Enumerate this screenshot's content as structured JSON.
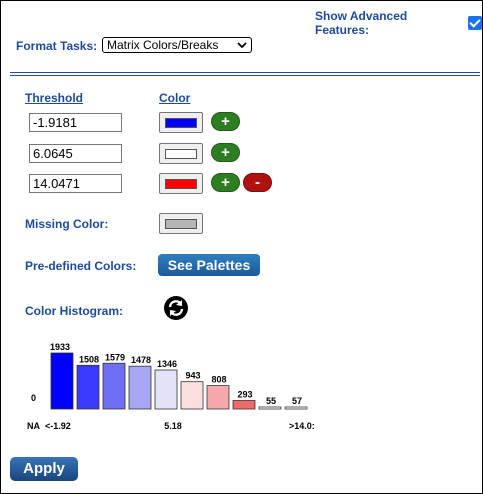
{
  "header": {
    "advanced_label": "Show Advanced Features:",
    "advanced_checked": true
  },
  "format": {
    "label": "Format Tasks:",
    "selected": "Matrix Colors/Breaks"
  },
  "columns": {
    "threshold": "Threshold",
    "color": "Color"
  },
  "thresholds": [
    {
      "value": "-1.9181",
      "color": "#0000ff"
    },
    {
      "value": "6.0645",
      "color": "#ffffff"
    },
    {
      "value": "14.0471",
      "color": "#ff0000"
    }
  ],
  "buttons": {
    "plus": "+",
    "minus": "-",
    "see_palettes": "See Palettes",
    "apply": "Apply"
  },
  "missing": {
    "label": "Missing Color:",
    "color": "#b4b4b4"
  },
  "predefined": {
    "label": "Pre-defined Colors:"
  },
  "histogram": {
    "label": "Color Histogram:"
  },
  "chart_data": {
    "type": "bar",
    "values": [
      1933,
      1508,
      1579,
      1478,
      1346,
      943,
      808,
      293,
      55,
      57
    ],
    "colors": [
      "#0000ff",
      "#3a3aff",
      "#6f6ff5",
      "#a6a6f5",
      "#e2e2f8",
      "#fcdede",
      "#f5a8a8",
      "#f06a6a",
      "#ffffff",
      "#ffffff"
    ],
    "y_zero_label": "0",
    "x_labels": [
      "NA",
      "<-1.92",
      "5.18",
      ">14.0:"
    ],
    "ylim": [
      0,
      1933
    ]
  }
}
